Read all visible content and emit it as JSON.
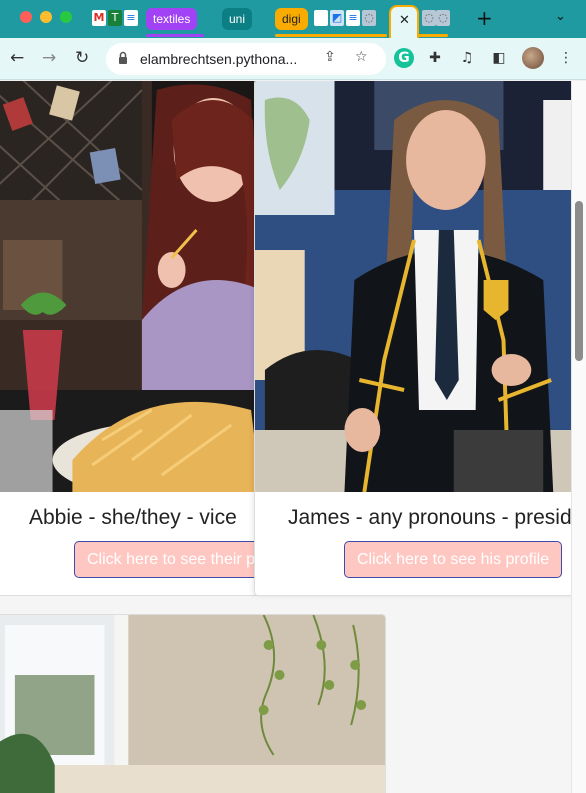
{
  "browser": {
    "tab_groups": [
      {
        "label": "textiles",
        "color": "#a142f4"
      },
      {
        "label": "uni",
        "color": "#0b7f84"
      },
      {
        "label": "digi",
        "color": "#f9ab00"
      }
    ],
    "active_tab_close": "✕",
    "new_tab_label": "+",
    "tab_list_label": "⌄",
    "url": "elambrechtsen.pythona...",
    "accent_color": "#1f9aa0"
  },
  "cards": [
    {
      "caption": "Abbie - she/they - vice",
      "button_label": "Click here to see their p"
    },
    {
      "caption": "James - any pronouns - presid",
      "button_label": "Click here to see his profile"
    }
  ]
}
